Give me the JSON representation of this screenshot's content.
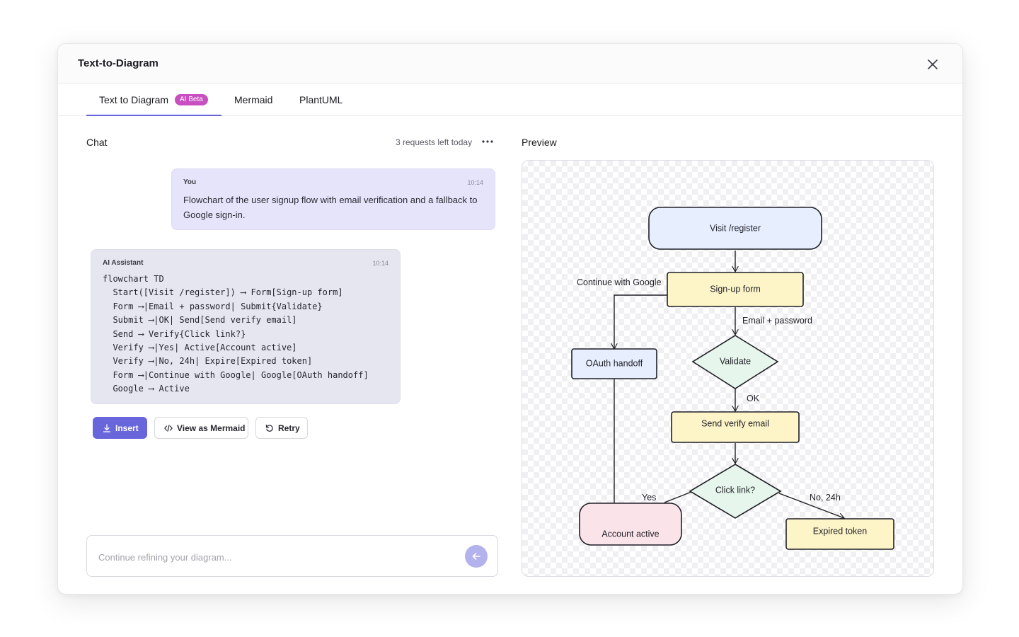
{
  "dialog": {
    "title": "Text-to-Diagram",
    "close_icon": "close-icon"
  },
  "tabs": [
    {
      "label": "Text to Diagram",
      "badge": "AI Beta",
      "active": true
    },
    {
      "label": "Mermaid",
      "active": false
    },
    {
      "label": "PlantUML",
      "active": false
    }
  ],
  "chat": {
    "label": "Chat",
    "requests_left": "3 requests left today",
    "more_icon": "more-horizontal-icon",
    "messages": [
      {
        "author": "You",
        "time": "10:14",
        "text": "Flowchart of the user signup flow with email verification and a fallback to Google sign-in."
      },
      {
        "author": "AI Assistant",
        "time": "10:14",
        "code": "flowchart TD\n  Start([Visit /register]) ⟶ Form[Sign-up form]\n  Form ⟶|Email + password| Submit{Validate}\n  Submit ⟶|OK| Send[Send verify email]\n  Send ⟶ Verify{Click link?}\n  Verify ⟶|Yes| Active[Account active]\n  Verify ⟶|No, 24h| Expire[Expired token]\n  Form ⟶|Continue with Google| Google[OAuth handoff]\n  Google ⟶ Active"
      }
    ],
    "actions": {
      "insert": "Insert",
      "view_mermaid": "View as Mermaid",
      "retry": "Retry"
    },
    "input": {
      "placeholder": "Continue refining your diagram...",
      "value": ""
    }
  },
  "preview": {
    "label": "Preview",
    "nodes": {
      "start": "Visit /register",
      "form": "Sign-up form",
      "oauth": "OAuth handoff",
      "validate": "Validate",
      "send": "Send verify email",
      "click": "Click link?",
      "active": "Account active",
      "expired": "Expired token"
    },
    "edge_labels": {
      "google": "Continue with Google",
      "email": "Email + password",
      "ok": "OK",
      "yes": "Yes",
      "no": "No, 24h"
    }
  },
  "colors": {
    "accent": "#6965db",
    "badge": "#c84fc0",
    "node_start": "#e7efff",
    "node_process": "#fdf4c8",
    "node_decision": "#e6f6ec",
    "node_active": "#fbe3ea"
  }
}
